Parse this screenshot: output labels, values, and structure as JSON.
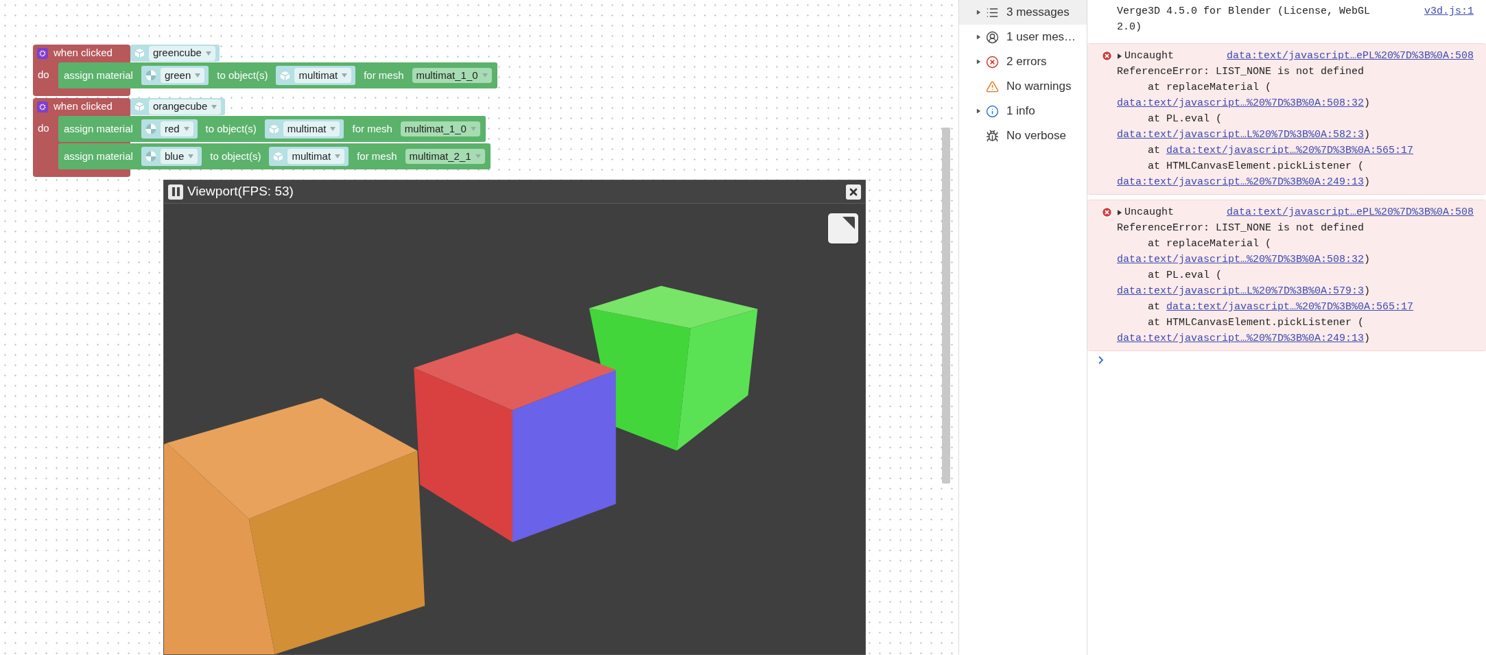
{
  "workspace": {
    "block_groups": [
      {
        "event": "when clicked",
        "object": "greencube",
        "do_label": "do",
        "statements": [
          {
            "action": "assign material",
            "material": "green",
            "to_label": "to object(s)",
            "object": "multimat",
            "mesh_label": "for mesh",
            "mesh": "multimat_1_0"
          }
        ]
      },
      {
        "event": "when clicked",
        "object": "orangecube",
        "do_label": "do",
        "statements": [
          {
            "action": "assign material",
            "material": "red",
            "to_label": "to object(s)",
            "object": "multimat",
            "mesh_label": "for mesh",
            "mesh": "multimat_1_0"
          },
          {
            "action": "assign material",
            "material": "blue",
            "to_label": "to object(s)",
            "object": "multimat",
            "mesh_label": "for mesh",
            "mesh": "multimat_2_1"
          }
        ]
      }
    ]
  },
  "viewport": {
    "title": "Viewport(FPS: 53)"
  },
  "console_sidebar": {
    "items": [
      {
        "kind": "messages",
        "label": "3 messages",
        "expandable": true,
        "selected": true
      },
      {
        "kind": "user",
        "label": "1 user mes…",
        "expandable": true,
        "selected": false
      },
      {
        "kind": "errors",
        "label": "2 errors",
        "expandable": true,
        "selected": false
      },
      {
        "kind": "warnings",
        "label": "No warnings",
        "expandable": false,
        "selected": false
      },
      {
        "kind": "info",
        "label": "1 info",
        "expandable": true,
        "selected": false
      },
      {
        "kind": "verbose",
        "label": "No verbose",
        "expandable": false,
        "selected": false
      }
    ]
  },
  "console": {
    "entries": [
      {
        "kind": "log",
        "text": "Verge3D 4.5.0 for Blender (License, WebGL 2.0)",
        "source": "v3d.js:1"
      },
      {
        "kind": "error",
        "label": "Uncaught",
        "source": "data:text/javascript…ePL%20%7D%3B%0A:508",
        "message": "ReferenceError: LIST_NONE is not defined",
        "frames": [
          {
            "wrapped": true,
            "prefix": "at replaceMaterial (",
            "link": "data:text/javascript…%20%7D%3B%0A:508:32",
            "suffix": ")"
          },
          {
            "wrapped": true,
            "prefix": "at PL.eval (",
            "link": "data:text/javascript…L%20%7D%3B%0A:582:3",
            "suffix": ")"
          },
          {
            "wrapped": false,
            "prefix": "at",
            "link": "data:text/javascript…%20%7D%3B%0A:565:17"
          },
          {
            "wrapped": true,
            "prefix": "at HTMLCanvasElement.pickListener (",
            "link": "data:text/javascript…%20%7D%3B%0A:249:13",
            "suffix": ")"
          }
        ]
      },
      {
        "kind": "error",
        "label": "Uncaught",
        "source": "data:text/javascript…ePL%20%7D%3B%0A:508",
        "message": "ReferenceError: LIST_NONE is not defined",
        "frames": [
          {
            "wrapped": true,
            "prefix": "at replaceMaterial (",
            "link": "data:text/javascript…%20%7D%3B%0A:508:32",
            "suffix": ")"
          },
          {
            "wrapped": true,
            "prefix": "at PL.eval (",
            "link": "data:text/javascript…L%20%7D%3B%0A:579:3",
            "suffix": ")"
          },
          {
            "wrapped": false,
            "prefix": "at",
            "link": "data:text/javascript…%20%7D%3B%0A:565:17"
          },
          {
            "wrapped": true,
            "prefix": "at HTMLCanvasElement.pickListener (",
            "link": "data:text/javascript…%20%7D%3B%0A:249:13",
            "suffix": ")"
          }
        ]
      }
    ]
  }
}
